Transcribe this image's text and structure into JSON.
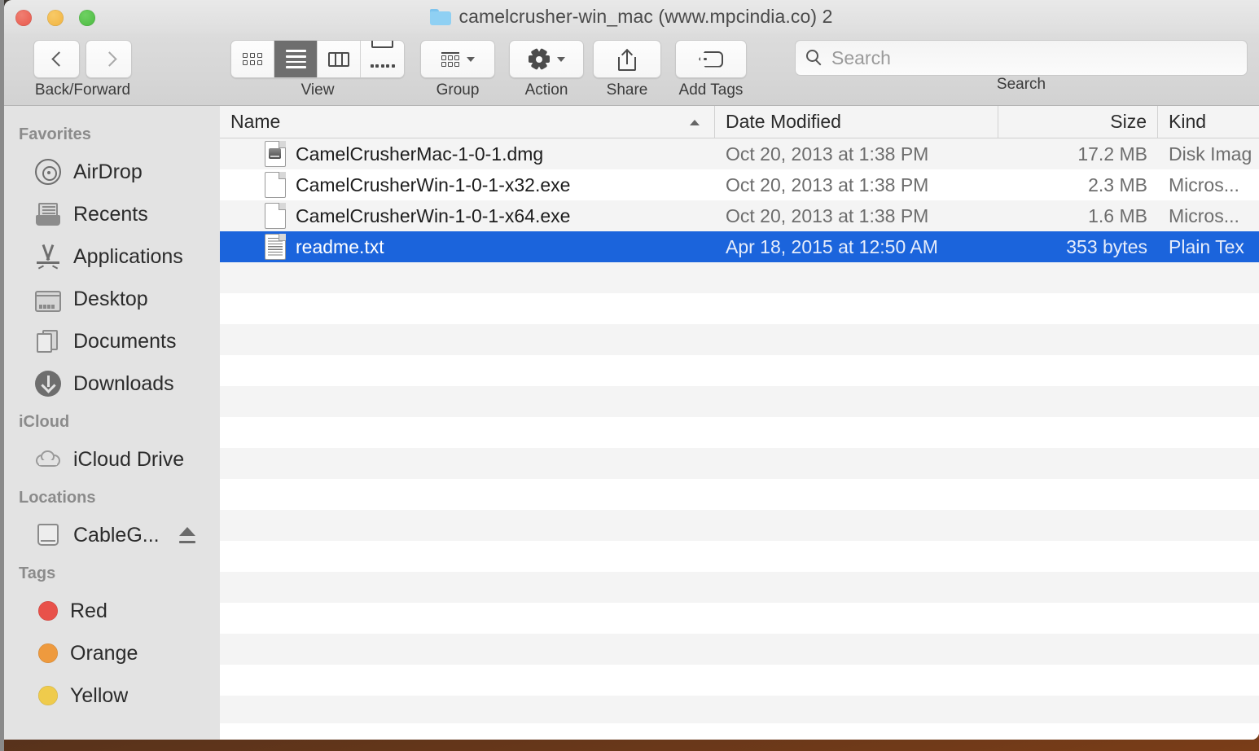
{
  "window": {
    "title": "camelcrusher-win_mac (www.mpcindia.co) 2",
    "folder_icon": "folder-icon",
    "traffic_lights": [
      {
        "name": "close",
        "color": "#ED6A5E"
      },
      {
        "name": "minimize",
        "color": "#F5BD4F"
      },
      {
        "name": "zoom",
        "color": "#61C554"
      }
    ]
  },
  "toolbar": {
    "nav": {
      "label": "Back/Forward",
      "back_icon": "chevron-left-icon",
      "forward_icon": "chevron-right-icon"
    },
    "view": {
      "label": "View",
      "options": [
        {
          "name": "icon-view",
          "icon": "grid-icon",
          "selected": false
        },
        {
          "name": "list-view",
          "icon": "list-icon",
          "selected": true
        },
        {
          "name": "column-view",
          "icon": "columns-icon",
          "selected": false
        },
        {
          "name": "gallery-view",
          "icon": "gallery-icon",
          "selected": false
        }
      ]
    },
    "group": {
      "label": "Group",
      "icon": "group-icon",
      "caret": "chevron-down-icon"
    },
    "action": {
      "label": "Action",
      "icon": "gear-icon",
      "caret": "chevron-down-icon"
    },
    "share": {
      "label": "Share",
      "icon": "share-icon"
    },
    "tags": {
      "label": "Add Tags",
      "icon": "tag-icon"
    },
    "search": {
      "label": "Search",
      "placeholder": "Search",
      "value": "",
      "icon": "search-icon"
    }
  },
  "sidebar": {
    "sections": [
      {
        "header": "Favorites",
        "items": [
          {
            "label": "AirDrop",
            "icon": "airdrop-icon"
          },
          {
            "label": "Recents",
            "icon": "recents-icon"
          },
          {
            "label": "Applications",
            "icon": "applications-icon"
          },
          {
            "label": "Desktop",
            "icon": "desktop-icon"
          },
          {
            "label": "Documents",
            "icon": "documents-icon"
          },
          {
            "label": "Downloads",
            "icon": "downloads-icon"
          }
        ]
      },
      {
        "header": "iCloud",
        "items": [
          {
            "label": "iCloud Drive",
            "icon": "cloud-icon"
          }
        ]
      },
      {
        "header": "Locations",
        "items": [
          {
            "label": "CableG...",
            "icon": "harddisk-icon",
            "eject": "eject-icon"
          }
        ]
      },
      {
        "header": "Tags",
        "items": [
          {
            "label": "Red",
            "icon": "tag-dot-icon",
            "color": "#E8514A"
          },
          {
            "label": "Orange",
            "icon": "tag-dot-icon",
            "color": "#EE9A3E"
          },
          {
            "label": "Yellow",
            "icon": "tag-dot-icon",
            "color": "#EFCB4C"
          }
        ]
      }
    ]
  },
  "filelist": {
    "columns": [
      {
        "key": "name",
        "label": "Name",
        "sort": "ascending",
        "sort_icon": "chevron-up-icon"
      },
      {
        "key": "date",
        "label": "Date Modified"
      },
      {
        "key": "size",
        "label": "Size"
      },
      {
        "key": "kind",
        "label": "Kind"
      }
    ],
    "rows": [
      {
        "name": "CamelCrusherMac-1-0-1.dmg",
        "date": "Oct 20, 2013 at 1:38 PM",
        "size": "17.2 MB",
        "kind": "Disk Imag",
        "icon": "disk-image-file-icon",
        "selected": false
      },
      {
        "name": "CamelCrusherWin-1-0-1-x32.exe",
        "date": "Oct 20, 2013 at 1:38 PM",
        "size": "2.3 MB",
        "kind": "Micros...",
        "icon": "generic-file-icon",
        "selected": false
      },
      {
        "name": "CamelCrusherWin-1-0-1-x64.exe",
        "date": "Oct 20, 2013 at 1:38 PM",
        "size": "1.6 MB",
        "kind": "Micros...",
        "icon": "generic-file-icon",
        "selected": false
      },
      {
        "name": "readme.txt",
        "date": "Apr 18, 2015 at 12:50 AM",
        "size": "353 bytes",
        "kind": "Plain Tex",
        "icon": "text-file-icon",
        "selected": true
      }
    ],
    "empty_row_count": 15,
    "selection_color": "#1B64DC"
  }
}
